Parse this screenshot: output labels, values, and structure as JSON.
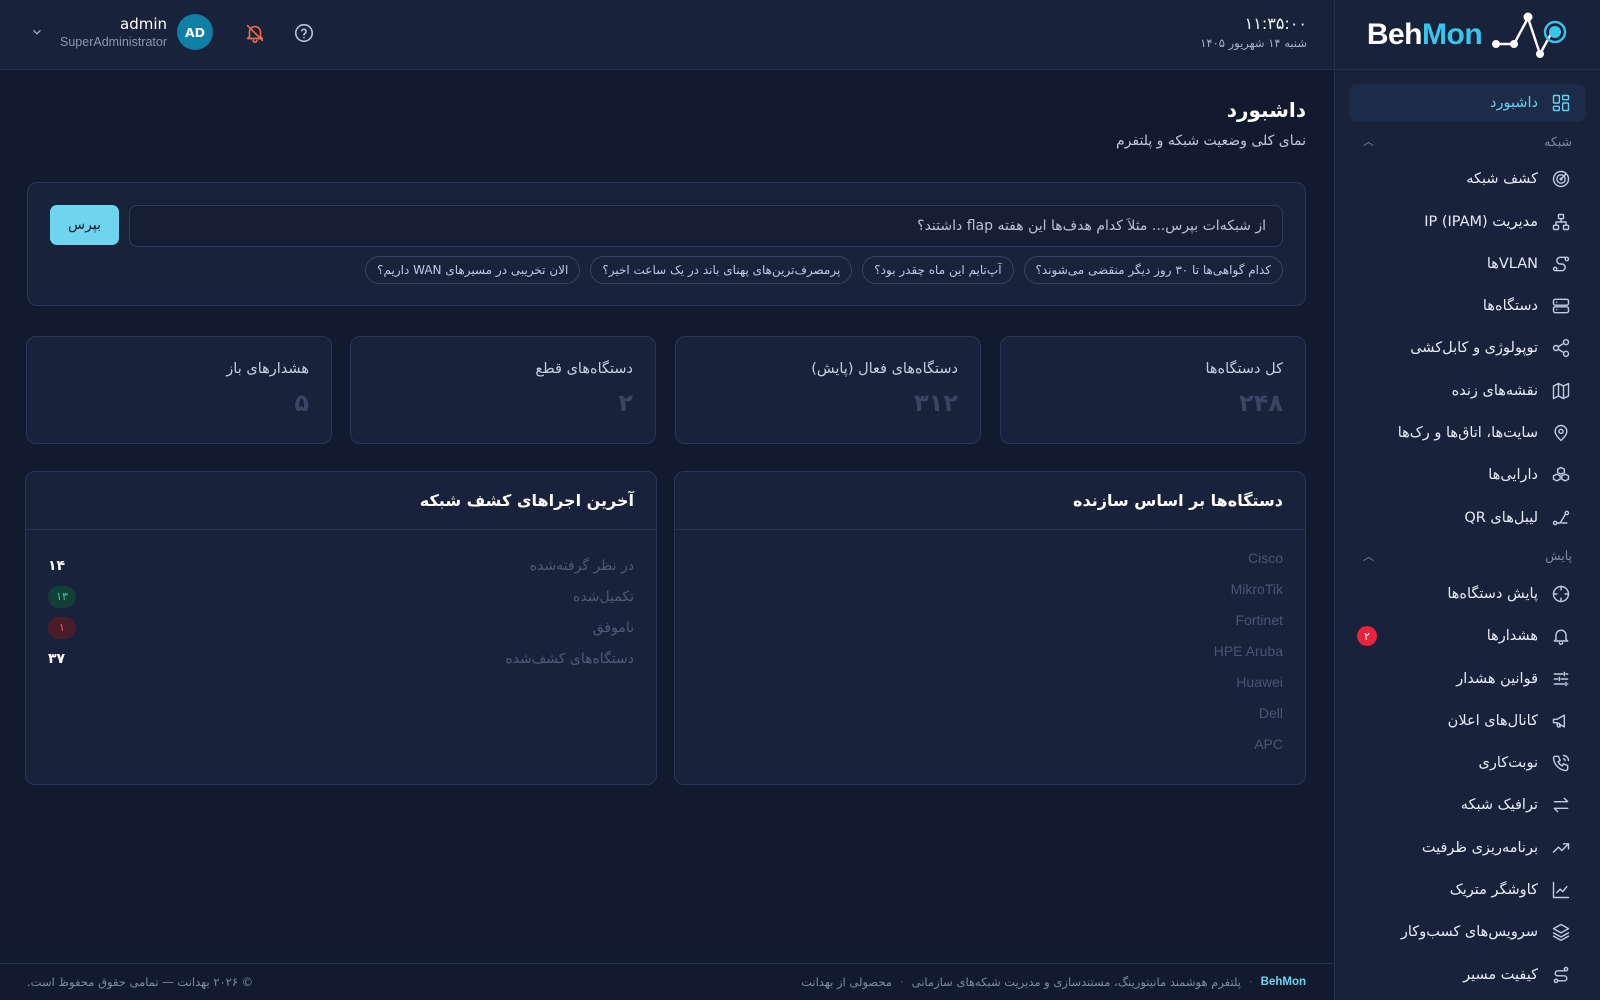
{
  "brand": {
    "part1": "Beh",
    "part2": "Mon"
  },
  "colors": {
    "accent": "#5fd4f2",
    "badge": "#e8233a",
    "bg": "#111a2e",
    "panel": "#18223a"
  },
  "header": {
    "time": "۱۱:۳۵:۰۰",
    "date": "شنبه ۱۴ شهریور ۱۴۰۵",
    "user_name": "admin",
    "user_role": "SuperAdministrator",
    "avatar_initials": "AD",
    "icons": [
      "chevron-down-icon",
      "bell-off-icon",
      "help-icon"
    ]
  },
  "sidebar": {
    "dashboard": {
      "label": "داشبورد",
      "icon": "dashboard-grid-icon"
    },
    "section_network": "شبکه",
    "network_items": [
      {
        "label": "کشف شبکه",
        "icon": "radar-icon"
      },
      {
        "label": "مدیریت IP (IPAM)",
        "icon": "network-tree-icon"
      },
      {
        "label": "VLANها",
        "icon": "vlan-icon"
      },
      {
        "label": "دستگاه‌ها",
        "icon": "server-icon"
      },
      {
        "label": "توپولوژی و کابل‌کشی",
        "icon": "share-icon"
      },
      {
        "label": "نقشه‌های زنده",
        "icon": "map-icon"
      },
      {
        "label": "سایت‌ها، اتاق‌ها و رک‌ها",
        "icon": "location-pin-icon"
      },
      {
        "label": "دارایی‌ها",
        "icon": "boxes-icon"
      },
      {
        "label": "لیبل‌های QR",
        "icon": "qr-label-icon"
      }
    ],
    "section_monitoring": "پایش",
    "monitoring_items": [
      {
        "label": "پایش دستگاه‌ها",
        "icon": "crosshair-icon",
        "badge": ""
      },
      {
        "label": "هشدارها",
        "icon": "bell-icon",
        "badge": "۲"
      },
      {
        "label": "قوانین هشدار",
        "icon": "sliders-icon",
        "badge": ""
      },
      {
        "label": "کانال‌های اعلان",
        "icon": "megaphone-icon",
        "badge": ""
      },
      {
        "label": "نوبت‌کاری",
        "icon": "phone-icon",
        "badge": ""
      },
      {
        "label": "ترافیک شبکه",
        "icon": "arrows-swap-icon",
        "badge": ""
      },
      {
        "label": "برنامه‌ریزی ظرفیت",
        "icon": "trend-up-icon",
        "badge": ""
      },
      {
        "label": "کاوشگر متریک",
        "icon": "line-chart-icon",
        "badge": ""
      },
      {
        "label": "سرویس‌های کسب‌وکار",
        "icon": "layers-icon",
        "badge": ""
      },
      {
        "label": "کیفیت مسیر",
        "icon": "route-icon",
        "badge": ""
      }
    ]
  },
  "page": {
    "title": "داشبورد",
    "subtitle": "نمای کلی وضعیت شبکه و پلتفرم"
  },
  "ask": {
    "placeholder": "از شبکه‌ات بپرس... مثلاً کدام هدف‌ها این هفته flap داشتند؟",
    "button": "بپرس",
    "chips": [
      "کدام گواهی‌ها تا ۳۰ روز دیگر منقضی می‌شوند؟",
      "آپ‌تایم این ماه چقدر بود؟",
      "پرمصرف‌ترین‌های پهنای باند در یک ساعت اخیر؟",
      "الان تخریبی در مسیرهای WAN داریم؟"
    ]
  },
  "stats": [
    {
      "label": "کل دستگاه‌ها",
      "value": "۲۴۸"
    },
    {
      "label": "دستگاه‌های فعال (پایش)",
      "value": "۳۱۲"
    },
    {
      "label": "دستگاه‌های قطع",
      "value": "۲"
    },
    {
      "label": "هشدارهای باز",
      "value": "۵"
    }
  ],
  "vendors_panel": {
    "title": "دستگاه‌ها بر اساس سازنده",
    "vendors": [
      "Cisco",
      "MikroTik",
      "Fortinet",
      "HPE Aruba",
      "Huawei",
      "Dell",
      "APC"
    ]
  },
  "discovery_panel": {
    "title": "آخرین اجراهای کشف شبکه",
    "rows": [
      {
        "label": "در نظر گرفته‌شده",
        "value": "۱۴"
      },
      {
        "label": "تکمیل‌شده",
        "value": "۱۳"
      },
      {
        "label": "ناموفق",
        "value": "۱"
      },
      {
        "label": "دستگاه‌های کشف‌شده",
        "value": "۳۷"
      }
    ]
  },
  "footer": {
    "brand": "BehMon",
    "tagline": "پلتفرم هوشمند مانیتورینگ، مستندسازی و مدیریت شبکه‌های سازمانی",
    "product_of": "محصولی از بهدانت",
    "copyright": "© ۲۰۲۶ بهدانت — تمامی حقوق محفوظ است."
  }
}
